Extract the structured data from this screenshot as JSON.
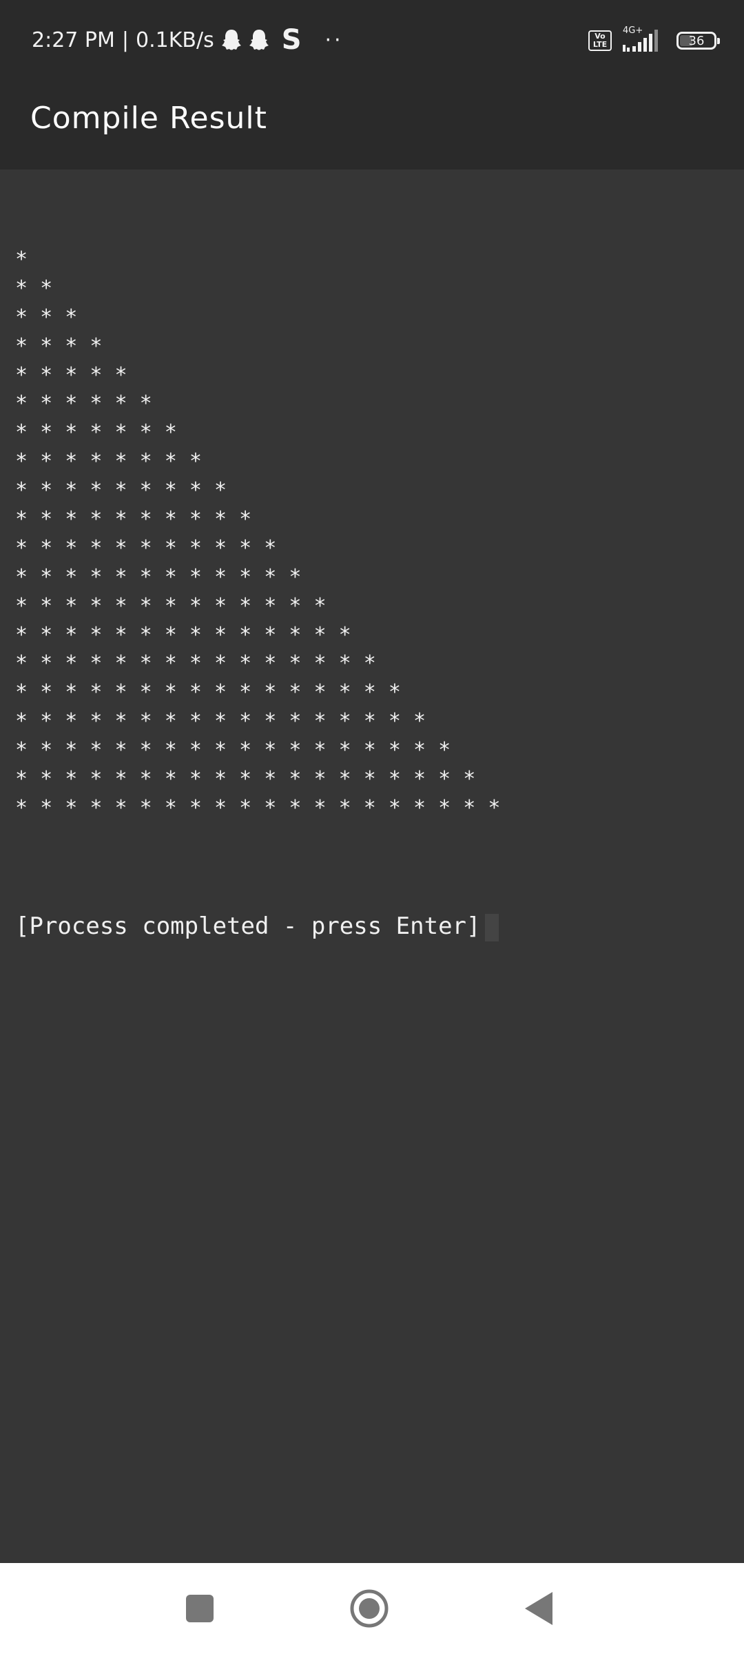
{
  "status_bar": {
    "time": "2:27 PM",
    "separator": "|",
    "net_speed": "0.1KB/s",
    "network_type": "4G+",
    "volte_label": "Vo\nLTE",
    "battery": "36",
    "icons": [
      "snapchat-ghost-icon",
      "snapchat-ghost-icon",
      "s-app-icon",
      "more-dots-icon",
      "volte-icon",
      "signal-icon",
      "battery-icon"
    ]
  },
  "app_bar": {
    "title": "Compile Result"
  },
  "output": {
    "rows": [
      "*",
      "* *",
      "* * *",
      "* * * *",
      "* * * * *",
      "* * * * * *",
      "* * * * * * *",
      "* * * * * * * *",
      "* * * * * * * * *",
      "* * * * * * * * * *",
      "* * * * * * * * * * *",
      "* * * * * * * * * * * *",
      "* * * * * * * * * * * * *",
      "* * * * * * * * * * * * * *",
      "* * * * * * * * * * * * * * *",
      "* * * * * * * * * * * * * * * *",
      "* * * * * * * * * * * * * * * * *",
      "* * * * * * * * * * * * * * * * * *",
      "* * * * * * * * * * * * * * * * * * *",
      "* * * * * * * * * * * * * * * * * * * *"
    ],
    "process_message": "[Process completed - press Enter]"
  },
  "nav_bar": {
    "buttons": [
      "recent-apps-icon",
      "home-icon",
      "back-icon"
    ]
  },
  "colors": {
    "background": "#363636",
    "app_bar": "#2a2a2a",
    "text": "#f0f0f0",
    "nav_bar": "#ffffff",
    "nav_icon": "#777777"
  }
}
